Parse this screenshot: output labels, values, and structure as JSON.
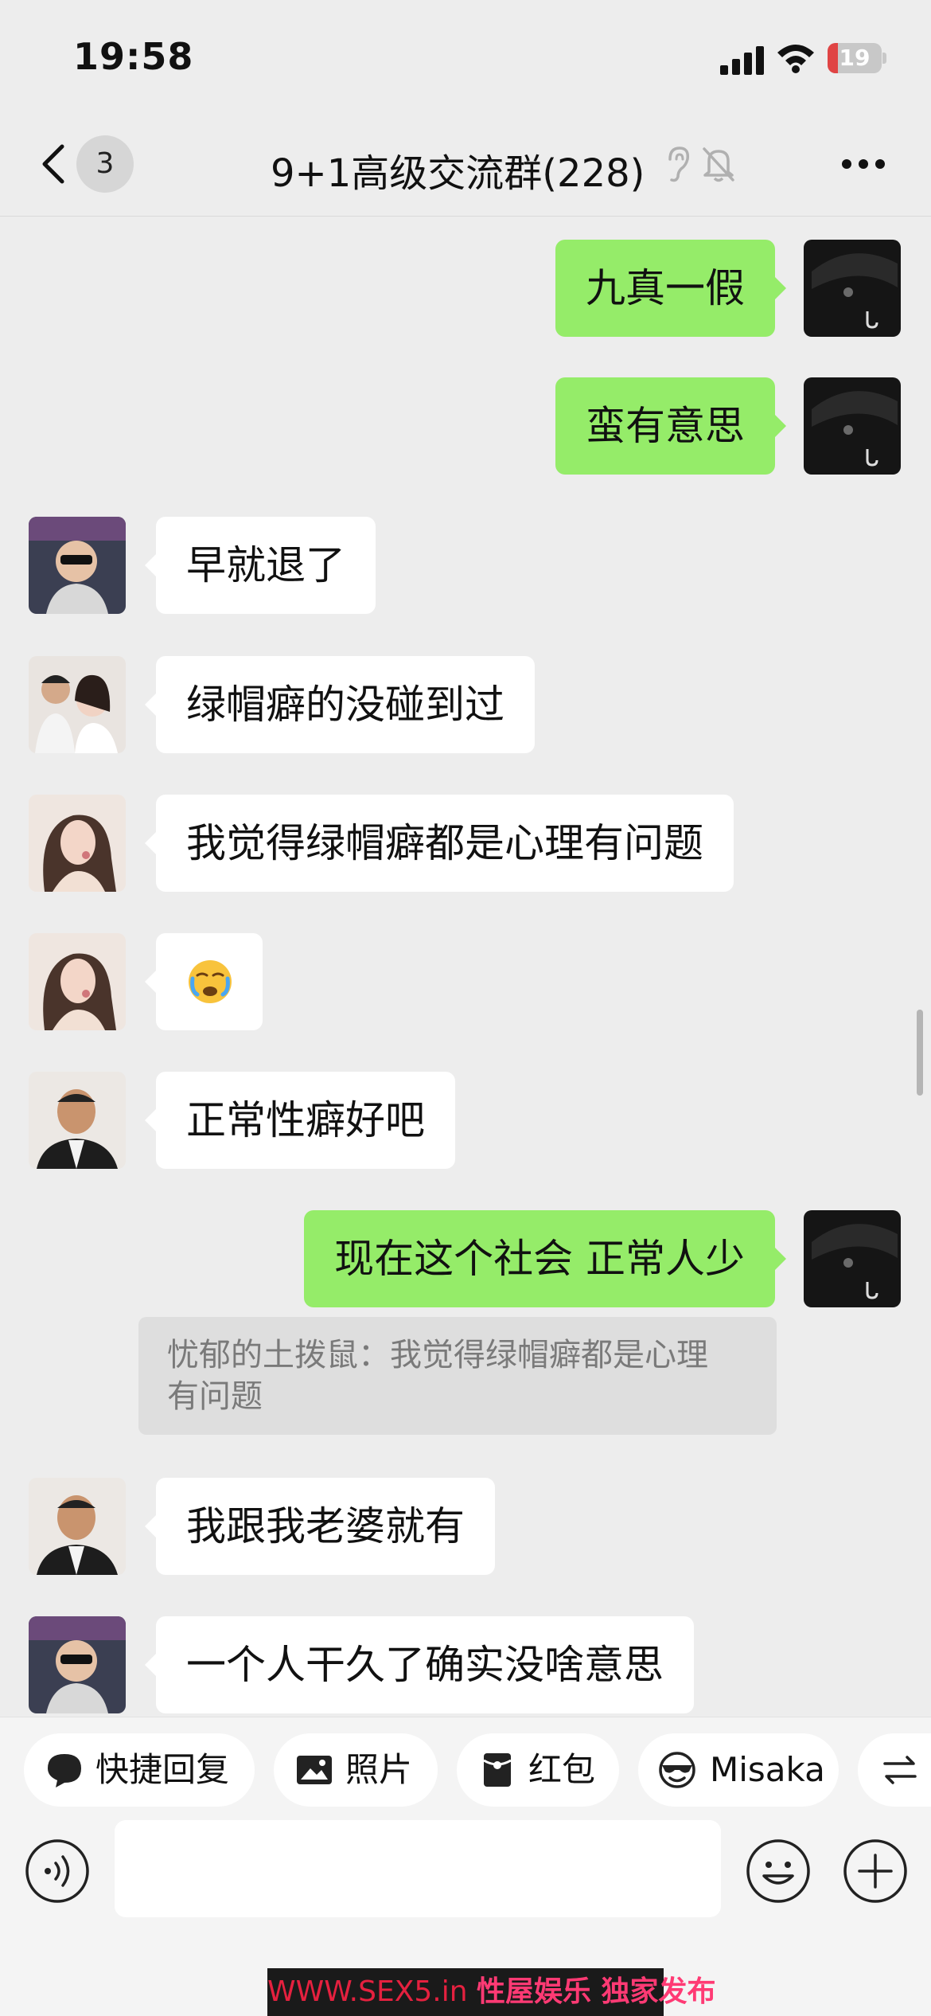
{
  "status_bar": {
    "time": "19:58",
    "battery_percent": "19",
    "battery_level": 0.19,
    "battery_color": "#e04444"
  },
  "nav": {
    "unread_count": "3",
    "title": "9+1高级交流群(228)"
  },
  "messages": [
    {
      "side": "out",
      "text": "九真一假",
      "avatar": "umbrella-avatar"
    },
    {
      "side": "out",
      "text": "蛮有意思",
      "avatar": "umbrella-avatar"
    },
    {
      "side": "in",
      "text": "早就退了",
      "avatar": "baby-sunglasses-avatar"
    },
    {
      "side": "in",
      "text": "绿帽癖的没碰到过",
      "avatar": "couple-photo-avatar"
    },
    {
      "side": "in",
      "text": "我觉得绿帽癖都是心理有问题",
      "avatar": "woman-portrait-avatar"
    },
    {
      "side": "in",
      "text": "😭",
      "avatar": "woman-portrait-avatar"
    },
    {
      "side": "in",
      "text": "正常性癖好吧",
      "avatar": "man-suit-avatar"
    },
    {
      "side": "out",
      "text": "现在这个社会 正常人少",
      "avatar": "umbrella-avatar"
    },
    {
      "side": "in",
      "text": "我跟我老婆就有",
      "avatar": "man-suit-avatar"
    },
    {
      "side": "in",
      "text": "一个人干久了确实没啥意思",
      "avatar": "baby-sunglasses-avatar"
    }
  ],
  "quote": {
    "line1": "忧郁的土拨鼠：我觉得绿帽癖都是心理",
    "line2": "有问题"
  },
  "quick_actions": [
    {
      "label": "快捷回复",
      "icon": "chat-bubble-icon"
    },
    {
      "label": "照片",
      "icon": "image-icon"
    },
    {
      "label": "红包",
      "icon": "red-packet-icon"
    },
    {
      "label": "Misaka",
      "icon": "sunglasses-face-icon"
    },
    {
      "label": "",
      "icon": "switch-arrows-icon"
    }
  ],
  "input": {
    "placeholder": ""
  },
  "watermark": {
    "site": "WWW.SEX5.in",
    "text": "性屋娱乐 独家发布"
  },
  "colors": {
    "background": "#ededed",
    "bubble_out": "#95ec69",
    "bubble_in": "#ffffff",
    "quote_bg": "#dedede"
  }
}
